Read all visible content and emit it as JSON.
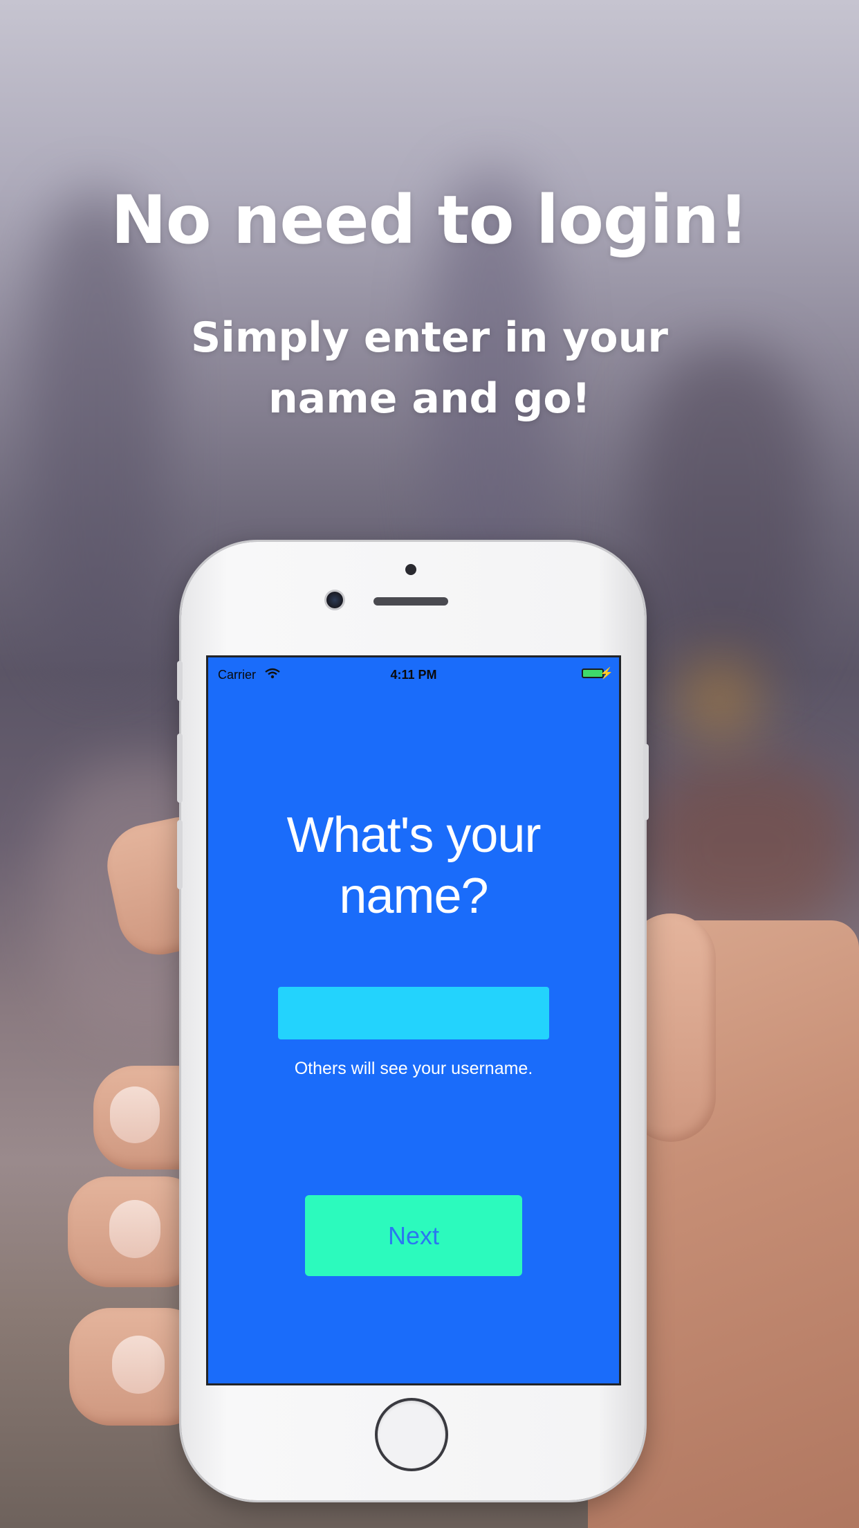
{
  "promo": {
    "headline": "No need to login!",
    "subline_1": "Simply enter in your",
    "subline_2": "name and go!"
  },
  "status_bar": {
    "carrier": "Carrier",
    "time": "4:11 PM",
    "wifi_icon": "wifi-icon",
    "battery_icon": "battery-icon",
    "charging_icon": "bolt-icon"
  },
  "app": {
    "question_line_1": "What's your",
    "question_line_2": "name?",
    "name_input_value": "",
    "hint": "Others will see your username.",
    "next_label": "Next"
  },
  "colors": {
    "screen_background": "#1a6cfa",
    "input_background": "#23d3fd",
    "button_background": "#2cfabd",
    "button_text": "#2a78f0",
    "battery_fill": "#3fd96a"
  }
}
